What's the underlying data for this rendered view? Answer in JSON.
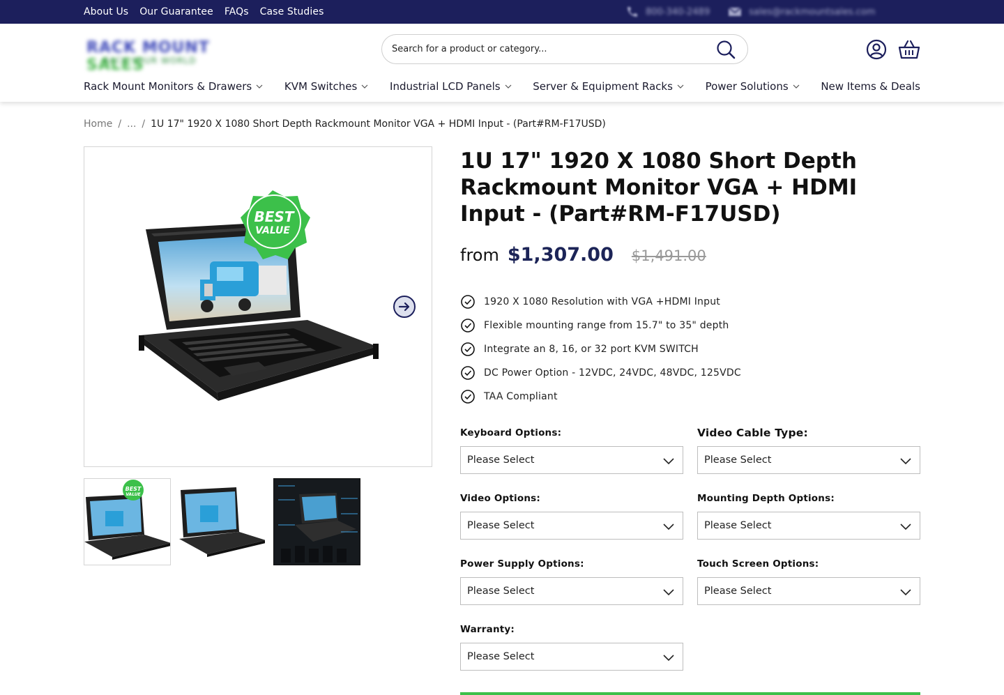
{
  "topbar": {
    "links": [
      "About Us",
      "Our Guarantee",
      "FAQs",
      "Case Studies"
    ],
    "phone": "800-340-2489",
    "email": "sales@rackmountsales.com"
  },
  "header": {
    "logo_text_a": "RACK MOUNT",
    "logo_text_b": "SALES",
    "logo_tagline": "RACK YOUR WORLD",
    "search_placeholder": "Search for a product or category...",
    "nav": [
      {
        "label": "Rack Mount Monitors & Drawers",
        "has_menu": true
      },
      {
        "label": "KVM Switches",
        "has_menu": true
      },
      {
        "label": "Industrial LCD Panels",
        "has_menu": true
      },
      {
        "label": "Server & Equipment Racks",
        "has_menu": true
      },
      {
        "label": "Power Solutions",
        "has_menu": true
      },
      {
        "label": "New Items & Deals",
        "has_menu": false
      }
    ]
  },
  "breadcrumb": {
    "home": "Home",
    "sep": "/",
    "ellipsis": "...",
    "current": "1U 17\" 1920 X 1080 Short Depth Rackmount Monitor VGA + HDMI Input - (Part#RM-F17USD)"
  },
  "gallery": {
    "badge_line1": "BEST",
    "badge_line2": "VALUE",
    "thumb_count": 3
  },
  "product": {
    "title": "1U 17\" 1920 X 1080 Short Depth Rackmount Monitor VGA + HDMI Input - (Part#RM-F17USD)",
    "from_label": "from",
    "price": "$1,307.00",
    "old_price": "$1,491.00",
    "features": [
      "1920 X 1080 Resolution with VGA +HDMI Input",
      "Flexible mounting range from 15.7\" to 35\" depth",
      "Integrate an 8, 16, or 32 port KVM SWITCH",
      "DC Power Option - 12VDC, 24VDC, 48VDC, 125VDC",
      "TAA Compliant"
    ]
  },
  "options": {
    "keyboard": {
      "label": "Keyboard Options:",
      "value": "Please Select"
    },
    "video_cable": {
      "label": "Video Cable Type:",
      "value": "Please Select"
    },
    "video": {
      "label": "Video Options:",
      "value": "Please Select"
    },
    "mounting_depth": {
      "label": "Mounting Depth Options:",
      "value": "Please Select"
    },
    "power_supply": {
      "label": "Power Supply Options:",
      "value": "Please Select"
    },
    "touch_screen": {
      "label": "Touch Screen Options:",
      "value": "Please Select"
    },
    "warranty": {
      "label": "Warranty:",
      "value": "Please Select"
    }
  },
  "colors": {
    "topbar": "#1c1f5c",
    "price": "#1c2457",
    "badge": "#3cc04a",
    "accent_bar": "#3cc04a"
  },
  "icons": [
    "phone-icon",
    "email-icon",
    "search-icon",
    "account-icon",
    "cart-icon",
    "chevron-down-icon",
    "check-circle-icon",
    "arrow-right-circle-icon"
  ]
}
